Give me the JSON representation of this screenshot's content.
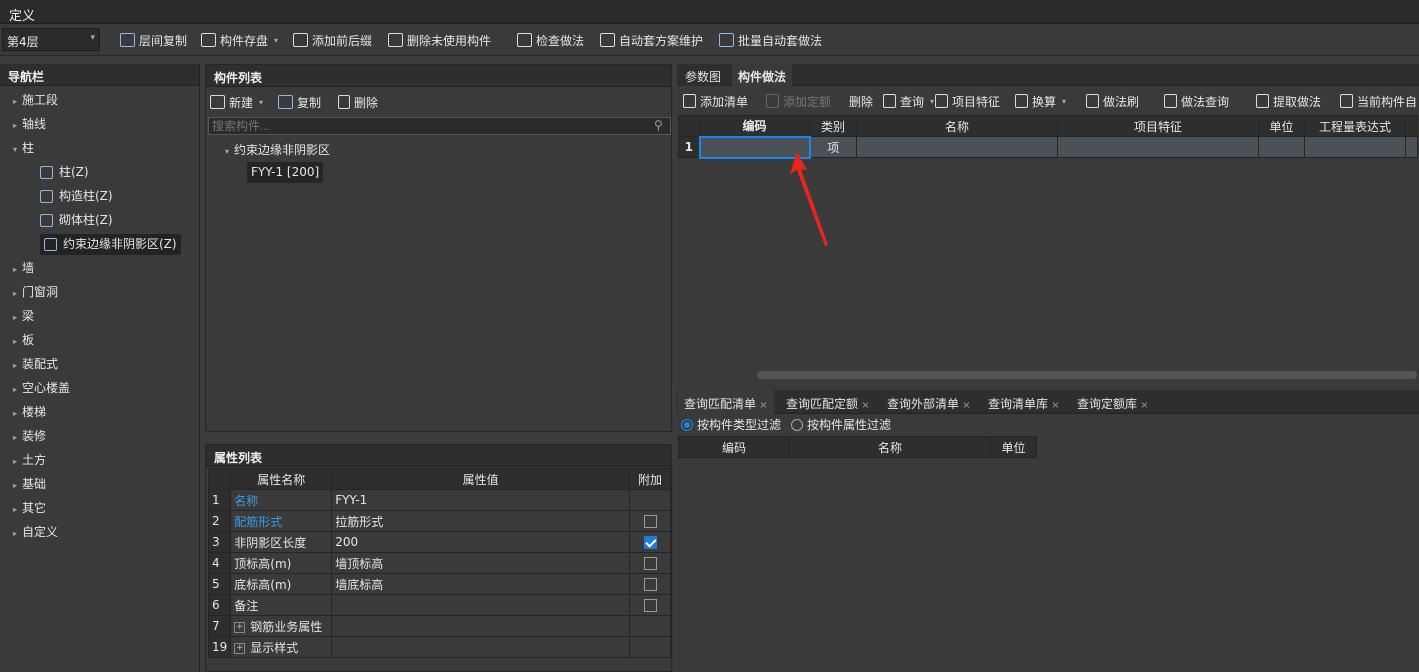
{
  "title": "定义",
  "toolbar": {
    "floor": "第4层",
    "items": [
      {
        "label": "层间复制",
        "caret": false
      },
      {
        "label": "构件存盘",
        "caret": true
      },
      {
        "label": "添加前后缀",
        "caret": false
      },
      {
        "label": "删除未使用构件",
        "caret": false
      },
      {
        "label": "检查做法",
        "caret": false
      },
      {
        "label": "自动套方案维护",
        "caret": false
      },
      {
        "label": "批量自动套做法",
        "caret": false
      }
    ]
  },
  "nav": {
    "title": "导航栏",
    "items": [
      {
        "label": "施工段",
        "level": 0,
        "expanded": false
      },
      {
        "label": "轴线",
        "level": 0,
        "expanded": false
      },
      {
        "label": "柱",
        "level": 0,
        "expanded": true
      },
      {
        "label": "柱(Z)",
        "level": 1
      },
      {
        "label": "构造柱(Z)",
        "level": 1
      },
      {
        "label": "砌体柱(Z)",
        "level": 1
      },
      {
        "label": "约束边缘非阴影区(Z)",
        "level": 1,
        "selected": true
      },
      {
        "label": "墙",
        "level": 0
      },
      {
        "label": "门窗洞",
        "level": 0
      },
      {
        "label": "梁",
        "level": 0
      },
      {
        "label": "板",
        "level": 0
      },
      {
        "label": "装配式",
        "level": 0
      },
      {
        "label": "空心楼盖",
        "level": 0
      },
      {
        "label": "楼梯",
        "level": 0
      },
      {
        "label": "装修",
        "level": 0
      },
      {
        "label": "土方",
        "level": 0
      },
      {
        "label": "基础",
        "level": 0
      },
      {
        "label": "其它",
        "level": 0
      },
      {
        "label": "自定义",
        "level": 0
      }
    ]
  },
  "component_list": {
    "title": "构件列表",
    "new_label": "新建",
    "copy_label": "复制",
    "delete_label": "删除",
    "search_placeholder": "搜索构件...",
    "group": "约束边缘非阴影区",
    "item": "FYY-1 [200]"
  },
  "attr_list": {
    "title": "属性列表",
    "headers": [
      "属性名称",
      "属性值",
      "附加"
    ],
    "rows": [
      {
        "no": "1",
        "name": "名称",
        "value": "FYY-1",
        "blue": true,
        "check": null
      },
      {
        "no": "2",
        "name": "配筋形式",
        "value": "拉筋形式",
        "blue": true,
        "check": false
      },
      {
        "no": "3",
        "name": "非阴影区长度",
        "value": "200",
        "blue": false,
        "check": true
      },
      {
        "no": "4",
        "name": "顶标高(m)",
        "value": "墙顶标高",
        "blue": false,
        "check": false
      },
      {
        "no": "5",
        "name": "底标高(m)",
        "value": "墙底标高",
        "blue": false,
        "check": false
      },
      {
        "no": "6",
        "name": "备注",
        "value": "",
        "blue": false,
        "check": false
      },
      {
        "no": "7",
        "name": "钢筋业务属性",
        "value": "",
        "blue": false,
        "check": null,
        "plus": true
      },
      {
        "no": "19",
        "name": "显示样式",
        "value": "",
        "blue": false,
        "check": null,
        "plus": true
      }
    ]
  },
  "right": {
    "tabs": [
      "参数图",
      "构件做法"
    ],
    "toolbar": [
      "添加清单",
      "添加定额",
      "删除",
      "查询",
      "项目特征",
      "换算",
      "做法刷",
      "做法查询",
      "提取做法",
      "当前构件自"
    ],
    "headers": [
      "编码",
      "类别",
      "名称",
      "项目特征",
      "单位",
      "工程量表达式"
    ],
    "row": {
      "no": "1",
      "type": "项"
    },
    "bottom_tabs": [
      "查询匹配清单",
      "查询匹配定额",
      "查询外部清单",
      "查询清单库",
      "查询定额库"
    ],
    "filter1": "按构件类型过滤",
    "filter2": "按构件属性过滤",
    "bottom_headers": [
      "编码",
      "名称",
      "单位"
    ]
  }
}
